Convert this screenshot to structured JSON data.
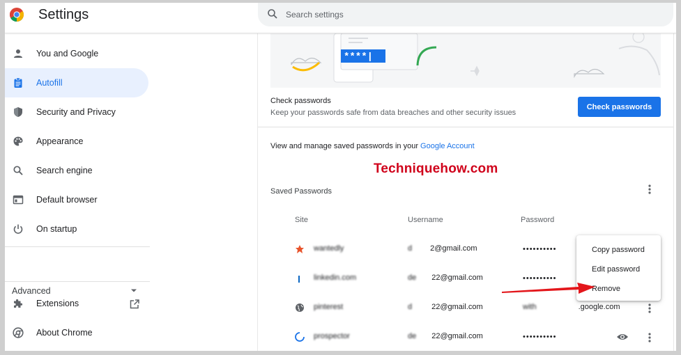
{
  "header": {
    "title": "Settings",
    "search_placeholder": "Search settings"
  },
  "sidebar": {
    "items": [
      {
        "label": "You and Google",
        "icon": "person-icon"
      },
      {
        "label": "Autofill",
        "icon": "clipboard-icon",
        "active": true
      },
      {
        "label": "Security and Privacy",
        "icon": "shield-icon"
      },
      {
        "label": "Appearance",
        "icon": "palette-icon"
      },
      {
        "label": "Search engine",
        "icon": "search-icon"
      },
      {
        "label": "Default browser",
        "icon": "browser-icon"
      },
      {
        "label": "On startup",
        "icon": "power-icon"
      }
    ],
    "advanced_label": "Advanced",
    "extensions_label": "Extensions",
    "about_label": "About Chrome"
  },
  "illustration": {
    "password_mask": "****|"
  },
  "check_passwords": {
    "title": "Check passwords",
    "subtitle": "Keep your passwords safe from data breaches and other security issues",
    "button_label": "Check passwords"
  },
  "manage": {
    "text": "View and manage saved passwords in your ",
    "link": "Google Account"
  },
  "watermark": "Techniquehow.com",
  "saved_passwords": {
    "label": "Saved Passwords",
    "columns": {
      "site": "Site",
      "username": "Username",
      "password": "Password"
    },
    "rows": [
      {
        "site": "wantedly",
        "username_prefix": "d",
        "username_suffix": "2@gmail.com",
        "password": "••••••••••"
      },
      {
        "site": "linkedin.com",
        "username_prefix": "de",
        "username_suffix": "22@gmail.com",
        "password": "••••••••••"
      },
      {
        "site": "pinterest",
        "username_prefix": "d",
        "username_suffix": "22@gmail.com",
        "password_prefix": "with",
        "password_suffix": ".google.com"
      },
      {
        "site": "prospector",
        "username_prefix": "de",
        "username_suffix": "22@gmail.com",
        "password": "••••••••••"
      }
    ]
  },
  "context_menu": {
    "items": [
      "Copy password",
      "Edit password",
      "Remove"
    ]
  },
  "colors": {
    "accent": "#1a73e8",
    "active_bg": "#e8f0fe",
    "arrow": "#e3161b",
    "watermark": "#d0021b"
  }
}
